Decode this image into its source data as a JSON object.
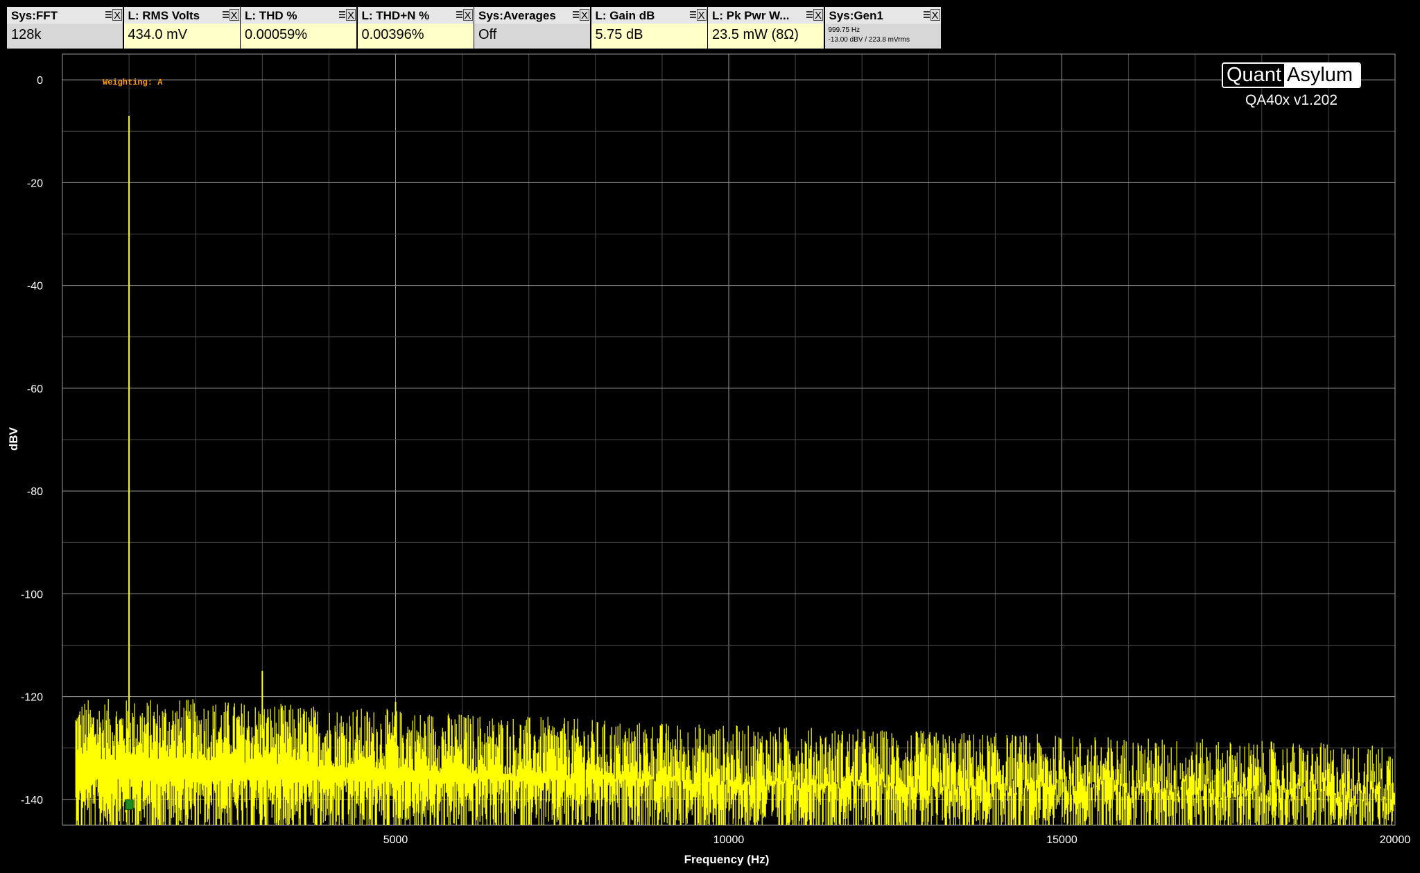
{
  "widgets": [
    {
      "title": "Sys:FFT",
      "value": "128k",
      "style": "gray"
    },
    {
      "title": "L: RMS Volts",
      "value": "434.0 mV",
      "style": "yellow"
    },
    {
      "title": "L: THD %",
      "value": "0.00059%",
      "style": "yellow"
    },
    {
      "title": "L: THD+N %",
      "value": "0.00396%",
      "style": "yellow"
    },
    {
      "title": "Sys:Averages",
      "value": "Off",
      "style": "gray"
    },
    {
      "title": "L: Gain dB",
      "value": "5.75 dB",
      "style": "yellow"
    },
    {
      "title": "L: Pk Pwr W...",
      "value": "23.5 mW (8Ω)",
      "style": "yellow"
    }
  ],
  "gen_widget": {
    "title": "Sys:Gen1",
    "line1": "999.75 Hz",
    "line2": "-13.00 dBV  / 223.8 mVrms"
  },
  "widget_icons": {
    "menu": "hamburger-icon",
    "close": "close-x-icon",
    "close_glyph": "X"
  },
  "logo": {
    "part1": "Quant",
    "part2": "Asylum",
    "version": "QA40x v1.202"
  },
  "annotation": {
    "weighting": "Weighting: A"
  },
  "colors": {
    "background": "#000000",
    "grid": "#808080",
    "trace": "#ffff00",
    "widget_yellow": "#ffffc8",
    "widget_gray": "#d7d7d7",
    "annotation": "#ff9900",
    "marker": "#1e8c1e"
  },
  "chart_data": {
    "type": "line",
    "title": "",
    "xlabel": "Frequency (Hz)",
    "ylabel": "dBV",
    "xlim": [
      0,
      20000
    ],
    "ylim": [
      -145,
      5
    ],
    "x_tick_labels": [
      "5000",
      "10000",
      "15000",
      "20000"
    ],
    "x_ticks": [
      5000,
      10000,
      15000,
      20000
    ],
    "y_tick_labels": [
      "0",
      "-20",
      "-40",
      "-60",
      "-80",
      "-100",
      "-120",
      "-140"
    ],
    "y_ticks": [
      0,
      -20,
      -40,
      -60,
      -80,
      -100,
      -120,
      -140
    ],
    "grid": true,
    "series": [
      {
        "color": "#ffff00",
        "peaks": [
          {
            "x": 1000,
            "y": -7
          },
          {
            "x": 3000,
            "y": -115
          },
          {
            "x": 5000,
            "y": -121
          }
        ],
        "noise_floor": {
          "x": [
            0,
            2000,
            5000,
            8000,
            10000,
            15000,
            20000
          ],
          "top_y": [
            -124,
            -124,
            -126,
            -128,
            -129,
            -131,
            -133
          ],
          "base_y": [
            -140,
            -140,
            -140,
            -140,
            -140,
            -140,
            -140
          ]
        }
      }
    ],
    "marker": {
      "x": 1000,
      "y": -141
    }
  }
}
